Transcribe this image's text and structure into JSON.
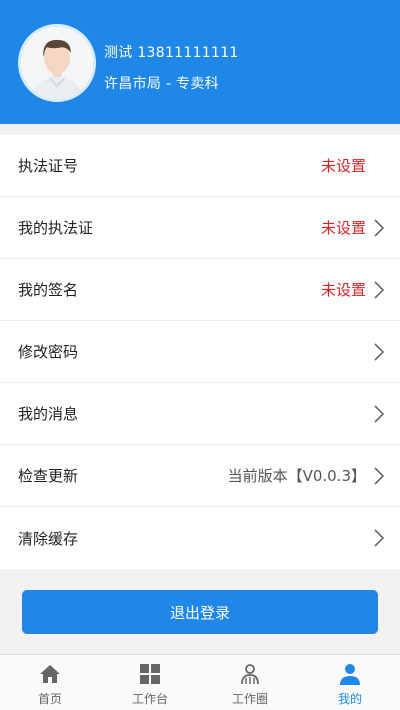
{
  "profile": {
    "name_phone": "测试 13811111111",
    "department": "许昌市局 - 专卖科"
  },
  "menu": {
    "items": [
      {
        "label": "执法证号",
        "value": "未设置",
        "chevron": false
      },
      {
        "label": "我的执法证",
        "value": "未设置",
        "chevron": true
      },
      {
        "label": "我的签名",
        "value": "未设置",
        "chevron": true
      },
      {
        "label": "修改密码",
        "value": "",
        "chevron": true
      },
      {
        "label": "我的消息",
        "value": "",
        "chevron": true
      },
      {
        "label": "检查更新",
        "value": "当前版本【V0.0.3】",
        "chevron": true
      },
      {
        "label": "清除缓存",
        "value": "",
        "chevron": true
      }
    ]
  },
  "logout_label": "退出登录",
  "tabbar": {
    "tabs": [
      {
        "label": "首页",
        "icon": "home-icon",
        "active": false
      },
      {
        "label": "工作台",
        "icon": "grid-icon",
        "active": false
      },
      {
        "label": "工作圈",
        "icon": "group-icon",
        "active": false
      },
      {
        "label": "我的",
        "icon": "user-icon",
        "active": true
      }
    ]
  },
  "colors": {
    "brand": "#1f87e8",
    "warning": "#d3262b",
    "tab_inactive": "#666666"
  }
}
